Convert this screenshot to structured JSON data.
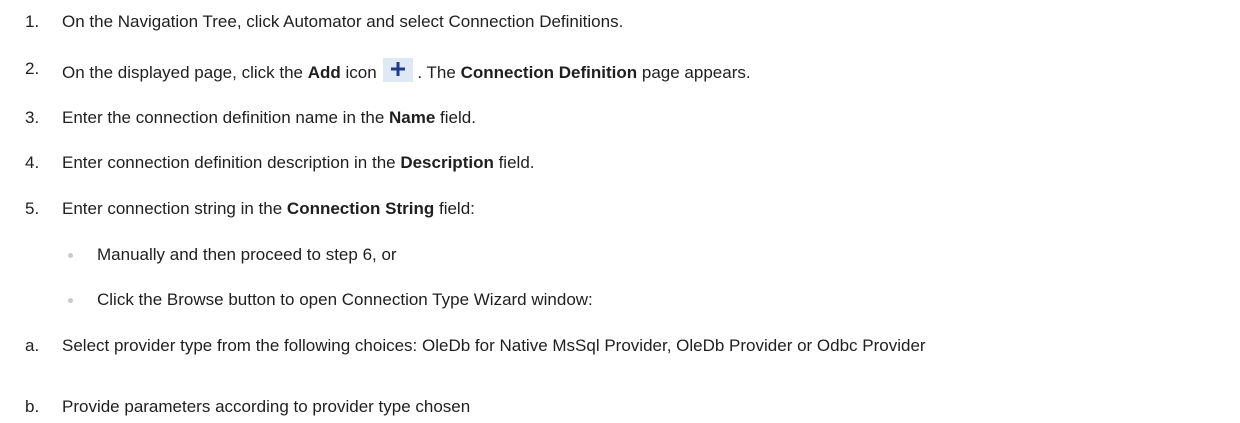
{
  "steps": [
    {
      "num": "1.",
      "text": "On the Navigation Tree, click Automator and select Connection Definitions."
    },
    {
      "num": "2.",
      "pre": "On the displayed page, click the ",
      "b1": "Add",
      "mid": " icon",
      "post": ". The ",
      "b2": "Connection Definition",
      "end": " page appears."
    },
    {
      "num": "3.",
      "pre": "Enter the connection definition name in the ",
      "b1": "Name",
      "end": " field."
    },
    {
      "num": "4.",
      "pre": "Enter connection definition description in the ",
      "b1": "Description",
      "end": " field."
    },
    {
      "num": "5.",
      "pre": "Enter connection string in the ",
      "b1": "Connection String",
      "end": " field:"
    }
  ],
  "bullets": [
    "Manually and then proceed to step 6, or",
    "Click the Browse button to open Connection Type Wizard window:"
  ],
  "substeps": [
    {
      "label": "a.",
      "text": "Select provider type from the following choices: OleDb for Native MsSql Provider, OleDb Provider or Odbc Provider"
    },
    {
      "label": "b.",
      "text": "Provide parameters according to provider type chosen"
    }
  ],
  "icons": {
    "add": "plus-icon",
    "add_color": "#1f3a8a"
  }
}
